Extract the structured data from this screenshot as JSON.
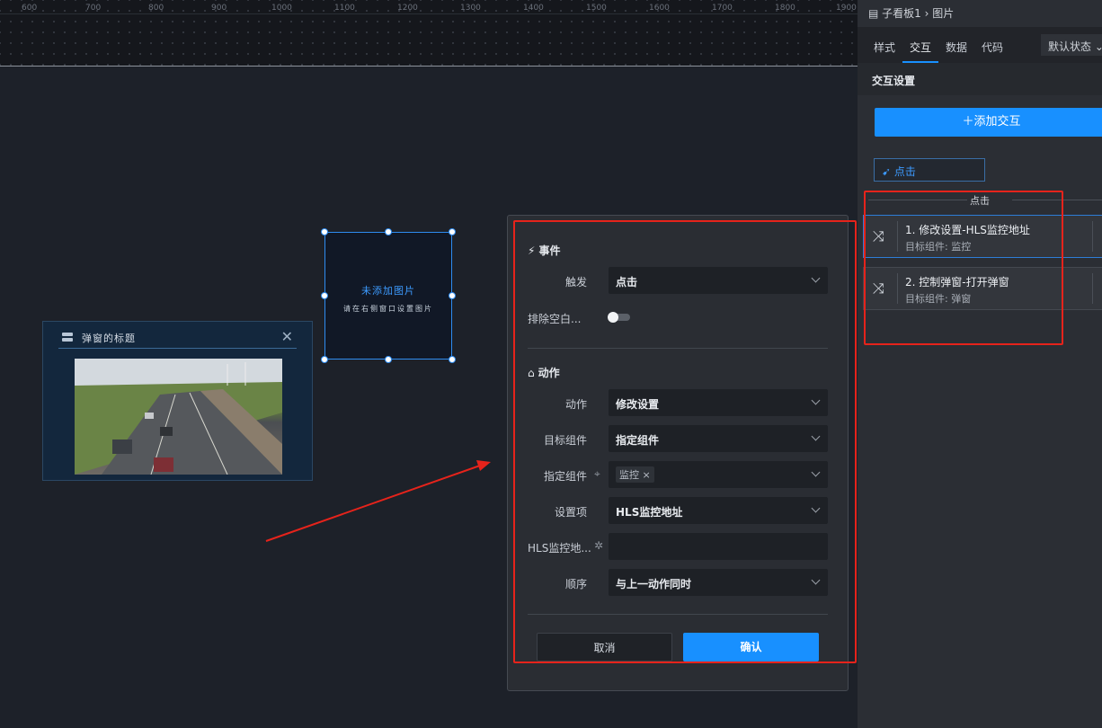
{
  "ruler": {
    "ticks": [
      "600",
      "700",
      "800",
      "900",
      "1000",
      "1100",
      "1200",
      "1300",
      "1400",
      "1500",
      "1600",
      "1700",
      "1800",
      "1900"
    ]
  },
  "popup_preview": {
    "title": "弹窗的标题",
    "close_glyph": "✕"
  },
  "image_component": {
    "title": "未添加图片",
    "subtitle": "请在右侧窗口设置图片"
  },
  "dialog": {
    "event_section": {
      "title": "事件",
      "glyph": "⚡"
    },
    "trigger": {
      "label": "触发",
      "value": "点击"
    },
    "exclude_blank": {
      "label": "排除空白...",
      "enabled": false
    },
    "action_section": {
      "title": "动作",
      "glyph": "⌂"
    },
    "action": {
      "label": "动作",
      "value": "修改设置"
    },
    "target": {
      "label": "目标组件",
      "value": "指定组件"
    },
    "specified": {
      "label": "指定组件",
      "tag": "监控 ×"
    },
    "setting_item": {
      "label": "设置项",
      "value": "HLS监控地址"
    },
    "hls": {
      "label": "HLS监控地...",
      "value": ""
    },
    "order": {
      "label": "顺序",
      "value": "与上一动作同时"
    },
    "cancel_label": "取消",
    "ok_label": "确认"
  },
  "panel": {
    "breadcrumb": "子看板1 › 图片",
    "tabs": [
      "样式",
      "交互",
      "数据",
      "代码"
    ],
    "active_tab": "交互",
    "state_select": "默认状态",
    "section_title": "交互设置",
    "add_button": "＋添加交互",
    "event_chip": "点击",
    "group_label": "点击",
    "actions": [
      {
        "title": "1. 修改设置-HLS监控地址",
        "target": "目标组件: 监控"
      },
      {
        "title": "2. 控制弹窗-打开弹窗",
        "target": "目标组件: 弹窗"
      }
    ]
  },
  "colors": {
    "accent": "#1890ff",
    "annotation": "#e6231b",
    "bg": "#1d2129"
  }
}
